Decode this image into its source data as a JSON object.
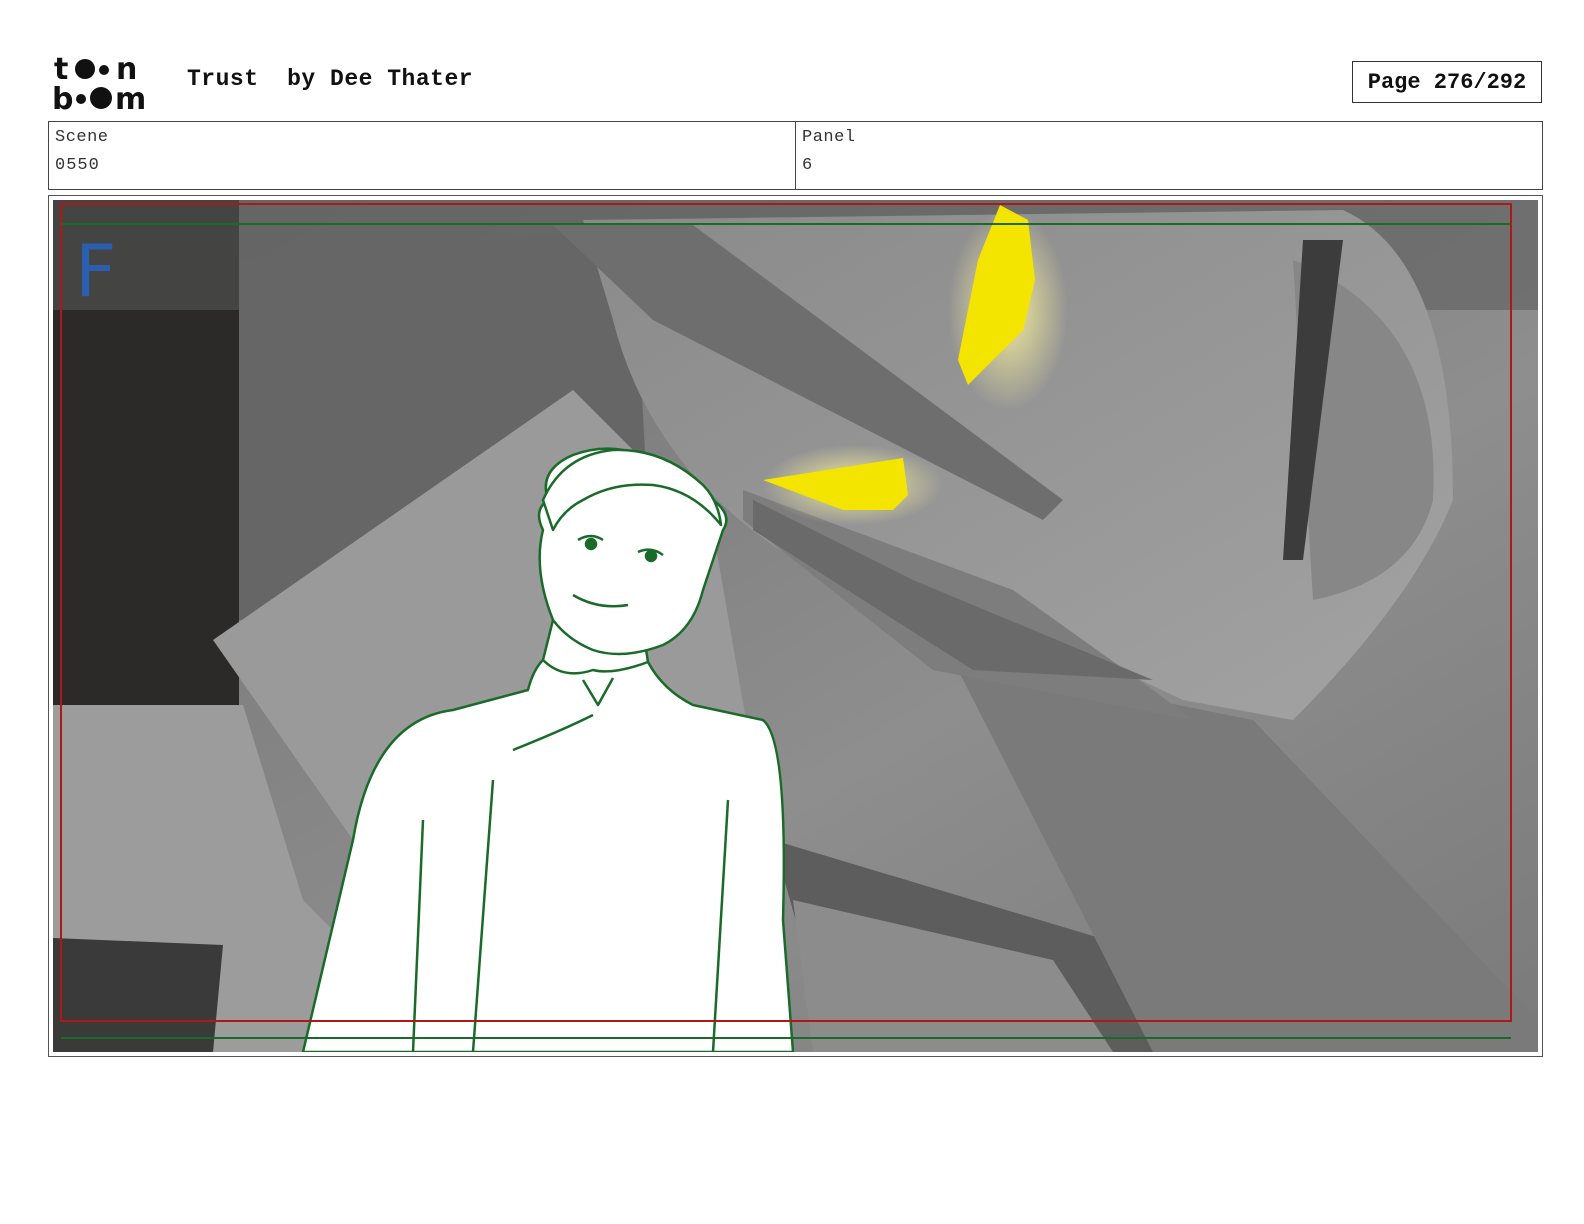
{
  "header": {
    "logo_top": "to●n",
    "logo_bottom": "b●●m",
    "title": "Trust  by Dee Thater",
    "page_label": "Page 276/292"
  },
  "info": {
    "scene_label": "Scene",
    "scene_value": "0550",
    "panel_label": "Panel",
    "panel_value": "6"
  },
  "panel": {
    "field_mark": "F",
    "colors": {
      "safe_red": "#b01818",
      "safe_green": "#1a6b2a",
      "sketch_green": "#1a6b2a",
      "eye_yellow": "#f4e500",
      "field_blue": "#2a5fb0"
    }
  }
}
